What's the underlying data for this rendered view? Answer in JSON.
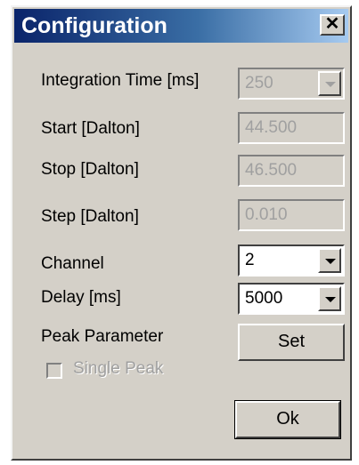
{
  "window": {
    "title": "Configuration",
    "close_label": "✕"
  },
  "fields": {
    "integration_time": {
      "label": "Integration Time [ms]",
      "value": "250"
    },
    "start": {
      "label": "Start [Dalton]",
      "value": "44.500"
    },
    "stop": {
      "label": "Stop [Dalton]",
      "value": "46.500"
    },
    "step": {
      "label": "Step [Dalton]",
      "value": "0.010"
    },
    "channel": {
      "label": "Channel",
      "value": "2"
    },
    "delay": {
      "label": "Delay [ms]",
      "value": "5000"
    }
  },
  "peak": {
    "label": "Peak Parameter",
    "set_label": "Set",
    "single_peak_label": "Single Peak"
  },
  "ok_label": "Ok"
}
